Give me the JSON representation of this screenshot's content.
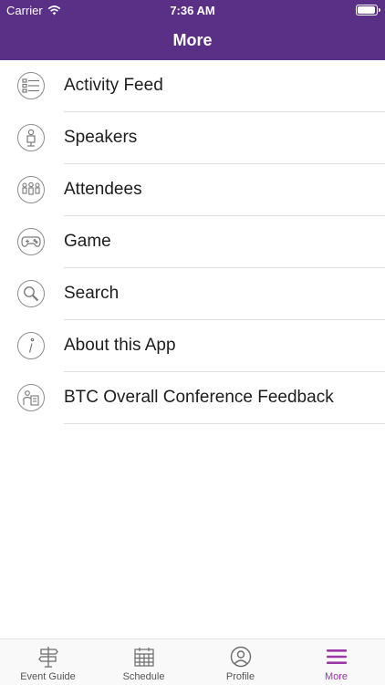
{
  "status_bar": {
    "carrier": "Carrier",
    "time": "7:36 AM"
  },
  "header": {
    "title": "More"
  },
  "menu": [
    {
      "label": "Activity Feed",
      "icon": "activity-feed-icon"
    },
    {
      "label": "Speakers",
      "icon": "speaker-icon"
    },
    {
      "label": "Attendees",
      "icon": "attendees-icon"
    },
    {
      "label": "Game",
      "icon": "game-controller-icon"
    },
    {
      "label": "Search",
      "icon": "search-icon"
    },
    {
      "label": "About this App",
      "icon": "info-icon"
    },
    {
      "label": "BTC Overall Conference Feedback",
      "icon": "feedback-icon"
    }
  ],
  "tabs": [
    {
      "label": "Event Guide",
      "icon": "signpost-icon",
      "active": false
    },
    {
      "label": "Schedule",
      "icon": "calendar-icon",
      "active": false
    },
    {
      "label": "Profile",
      "icon": "profile-icon",
      "active": false
    },
    {
      "label": "More",
      "icon": "hamburger-menu-icon",
      "active": true
    }
  ],
  "colors": {
    "header": "#5a3087",
    "active_tab": "#9b3aa6"
  }
}
